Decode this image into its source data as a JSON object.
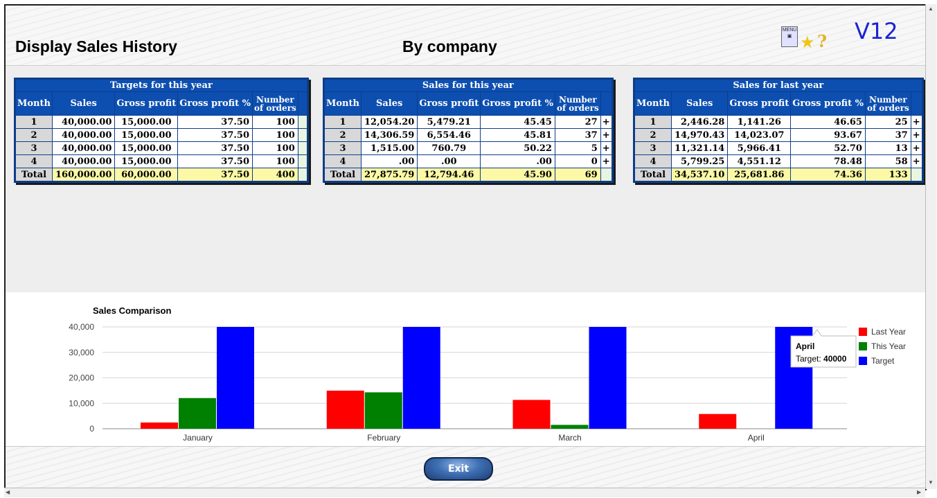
{
  "header": {
    "title": "Display Sales History",
    "subtitle": "By company",
    "version": "V12",
    "menu_icon_label": "MENU"
  },
  "tables": {
    "targets": {
      "caption": "Targets for this year",
      "headers": {
        "month": "Month",
        "sales": "Sales",
        "gp": "Gross profit",
        "gpp": "Gross profit %",
        "orders_1": "Number",
        "orders_2": "of orders"
      },
      "rows": [
        {
          "m": "1",
          "s": "40,000.00",
          "gp": "15,000.00",
          "gpp": "37.50",
          "o": "100"
        },
        {
          "m": "2",
          "s": "40,000.00",
          "gp": "15,000.00",
          "gpp": "37.50",
          "o": "100"
        },
        {
          "m": "3",
          "s": "40,000.00",
          "gp": "15,000.00",
          "gpp": "37.50",
          "o": "100"
        },
        {
          "m": "4",
          "s": "40,000.00",
          "gp": "15,000.00",
          "gpp": "37.50",
          "o": "100"
        }
      ],
      "total": {
        "m": "Total",
        "s": "160,000.00",
        "gp": "60,000.00",
        "gpp": "37.50",
        "o": "400"
      }
    },
    "this_year": {
      "caption": "Sales for this year",
      "headers": {
        "month": "Month",
        "sales": "Sales",
        "gp": "Gross profit",
        "gpp": "Gross profit %",
        "orders_1": "Number",
        "orders_2": "of orders"
      },
      "rows": [
        {
          "m": "1",
          "s": "12,054.20",
          "gp": "5,479.21",
          "gpp": "45.45",
          "o": "27"
        },
        {
          "m": "2",
          "s": "14,306.59",
          "gp": "6,554.46",
          "gpp": "45.81",
          "o": "37"
        },
        {
          "m": "3",
          "s": "1,515.00",
          "gp": "760.79",
          "gpp": "50.22",
          "o": "5"
        },
        {
          "m": "4",
          "s": ".00",
          "gp": ".00",
          "gpp": ".00",
          "o": "0"
        }
      ],
      "total": {
        "m": "Total",
        "s": "27,875.79",
        "gp": "12,794.46",
        "gpp": "45.90",
        "o": "69"
      }
    },
    "last_year": {
      "caption": "Sales for last year",
      "headers": {
        "month": "Month",
        "sales": "Sales",
        "gp": "Gross profit",
        "gpp": "Gross profit %",
        "orders_1": "Number",
        "orders_2": "of orders"
      },
      "rows": [
        {
          "m": "1",
          "s": "2,446.28",
          "gp": "1,141.26",
          "gpp": "46.65",
          "o": "25"
        },
        {
          "m": "2",
          "s": "14,970.43",
          "gp": "14,023.07",
          "gpp": "93.67",
          "o": "37"
        },
        {
          "m": "3",
          "s": "11,321.14",
          "gp": "5,966.41",
          "gpp": "52.70",
          "o": "13"
        },
        {
          "m": "4",
          "s": "5,799.25",
          "gp": "4,551.12",
          "gpp": "78.48",
          "o": "58"
        }
      ],
      "total": {
        "m": "Total",
        "s": "34,537.10",
        "gp": "25,681.86",
        "gpp": "74.36",
        "o": "133"
      }
    },
    "expand_symbol": "+"
  },
  "chart_data": {
    "type": "bar",
    "title": "Sales Comparison",
    "categories": [
      "January",
      "February",
      "March",
      "April"
    ],
    "series": [
      {
        "name": "Last Year",
        "color": "#ff0000",
        "values": [
          2446.28,
          14970.43,
          11321.14,
          5799.25
        ]
      },
      {
        "name": "This Year",
        "color": "#008000",
        "values": [
          12054.2,
          14306.59,
          1515.0,
          0
        ]
      },
      {
        "name": "Target",
        "color": "#0000ff",
        "values": [
          40000,
          40000,
          40000,
          40000
        ]
      }
    ],
    "yticks": [
      "0",
      "10,000",
      "20,000",
      "30,000",
      "40,000"
    ],
    "ylim": [
      0,
      40000
    ],
    "grid": true,
    "legend": "right",
    "tooltip": {
      "category": "April",
      "label": "Target: ",
      "value": "40000"
    }
  },
  "footer": {
    "exit_label": "Exit"
  }
}
